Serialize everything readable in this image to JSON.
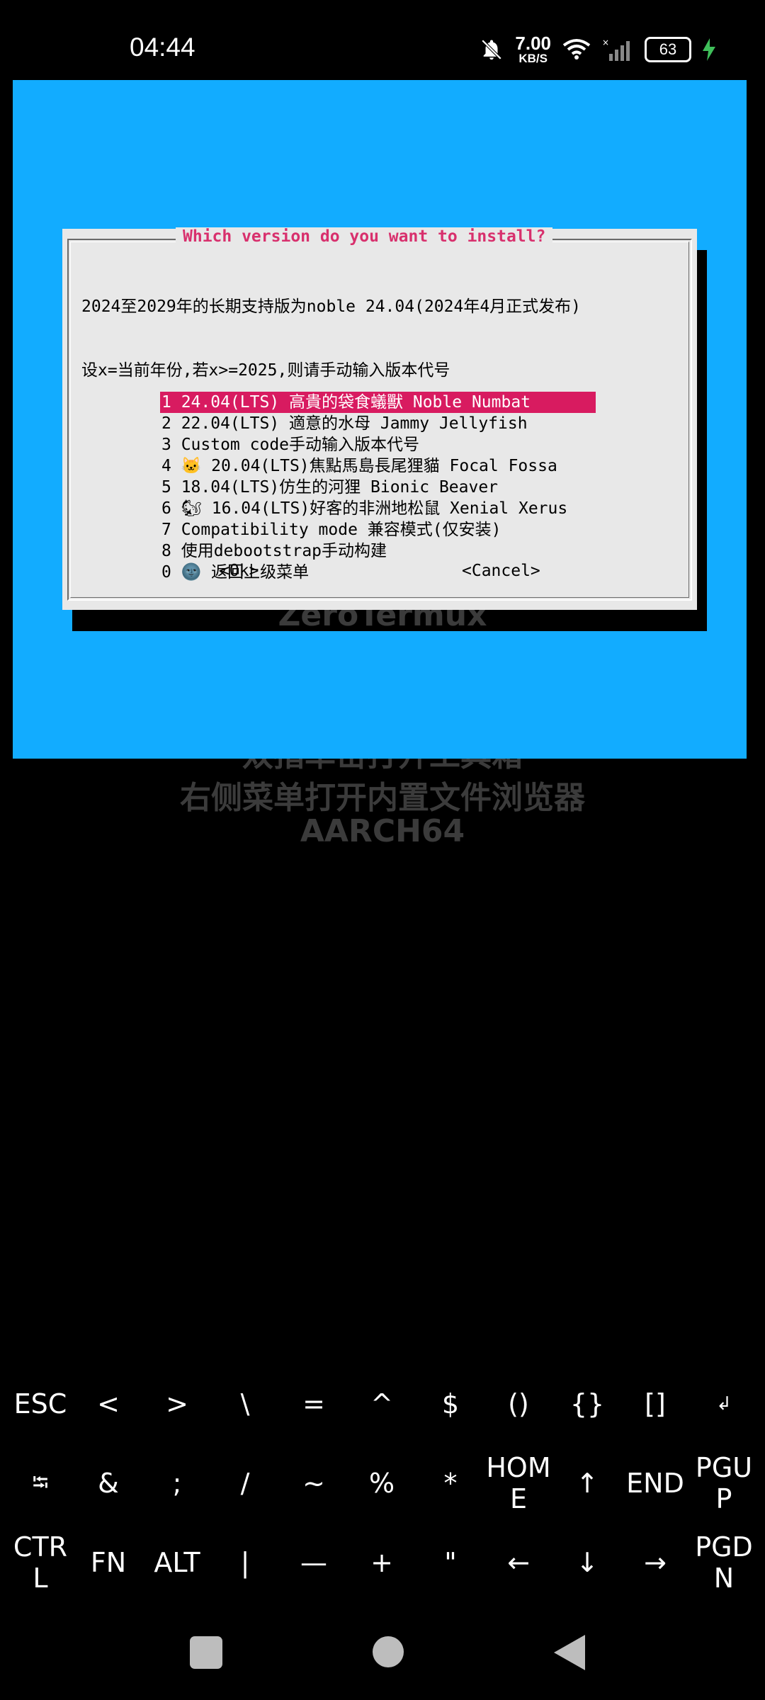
{
  "status_bar": {
    "time": "04:44",
    "net_speed_value": "7.00",
    "net_speed_unit": "KB/S",
    "battery": "63"
  },
  "terminal": {
    "watermark": {
      "line_top": "ZeroTermux",
      "line1": "双指单击打开工具箱",
      "line2": "右侧菜单打开内置文件浏览器",
      "line3": "AARCH64"
    },
    "dialog": {
      "title": "Which version do you want to install?",
      "description": [
        "2024至2029年的长期支持版为noble 24.04(2024年4月正式发布)",
        "设x=当前年份,若x>=2025,则请手动输入版本代号"
      ],
      "items": [
        "1 24.04(LTS) 高貴的袋食蟻獸 Noble Numbat",
        "2 22.04(LTS) 適意的水母 Jammy Jellyfish",
        "3 Custom code手动输入版本代号",
        "4 🐱 20.04(LTS)焦點馬島長尾狸貓 Focal Fossa",
        "5 18.04(LTS)仿生的河狸 Bionic Beaver",
        "6 🐿 16.04(LTS)好客的非洲地松鼠 Xenial Xerus",
        "7 Compatibility mode 兼容模式(仅安装)",
        "8 使用debootstrap手动构建",
        "0 🌚 返回上级菜单"
      ],
      "selected_index": 0,
      "ok_label": "<Ok>",
      "cancel_label": "<Cancel>"
    }
  },
  "extra_keys": [
    [
      "ESC",
      "<",
      ">",
      "\\",
      "=",
      "^",
      "$",
      "()",
      "{}",
      "[]",
      "↲"
    ],
    [
      "⭾",
      "&",
      ";",
      "/",
      "~",
      "%",
      "*",
      "HOME",
      "↑",
      "END",
      "PGUP"
    ],
    [
      "CTRL",
      "FN",
      "ALT",
      "|",
      "—",
      "+",
      "\"",
      "←",
      "↓",
      "→",
      "PGDN"
    ]
  ],
  "colors": {
    "terminal_bg": "#12acff",
    "dialog_bg": "#e8e8e8",
    "title": "#d8306d",
    "selection": "#d81b60"
  }
}
